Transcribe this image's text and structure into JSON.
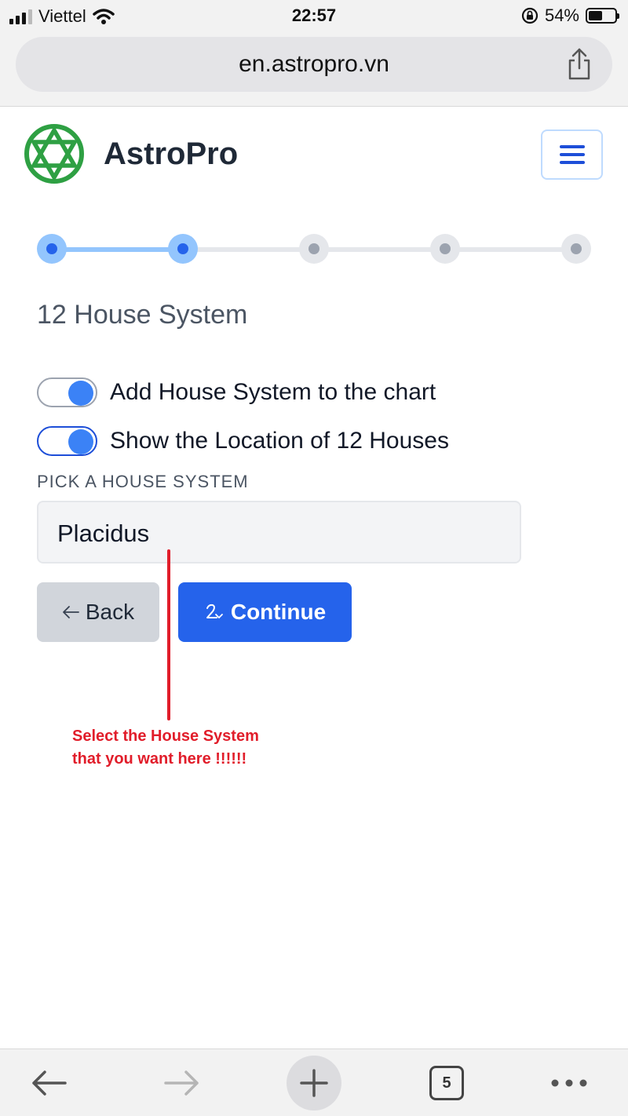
{
  "status_bar": {
    "carrier": "Viettel",
    "time": "22:57",
    "battery": "54%",
    "battery_level": 0.54
  },
  "browser": {
    "url": "en.astropro.vn",
    "tab_count": "5"
  },
  "header": {
    "brand": "AstroPro"
  },
  "stepper": {
    "total_steps": 5,
    "current_step": 2
  },
  "form": {
    "section_title": "12 House System",
    "toggle_add_house": "Add House System to the chart",
    "toggle_show_location": "Show the Location of 12 Houses",
    "pick_label": "PICK A HOUSE SYSTEM",
    "selected_house_system": "Placidus",
    "back_label": "Back",
    "continue_label": "Continue"
  },
  "annotation": {
    "line1": "Select the House System",
    "line2": "that you want here !!!!!!"
  },
  "colors": {
    "accent": "#2563eb",
    "logo": "#2ea043",
    "annotation": "#e11d2a"
  }
}
